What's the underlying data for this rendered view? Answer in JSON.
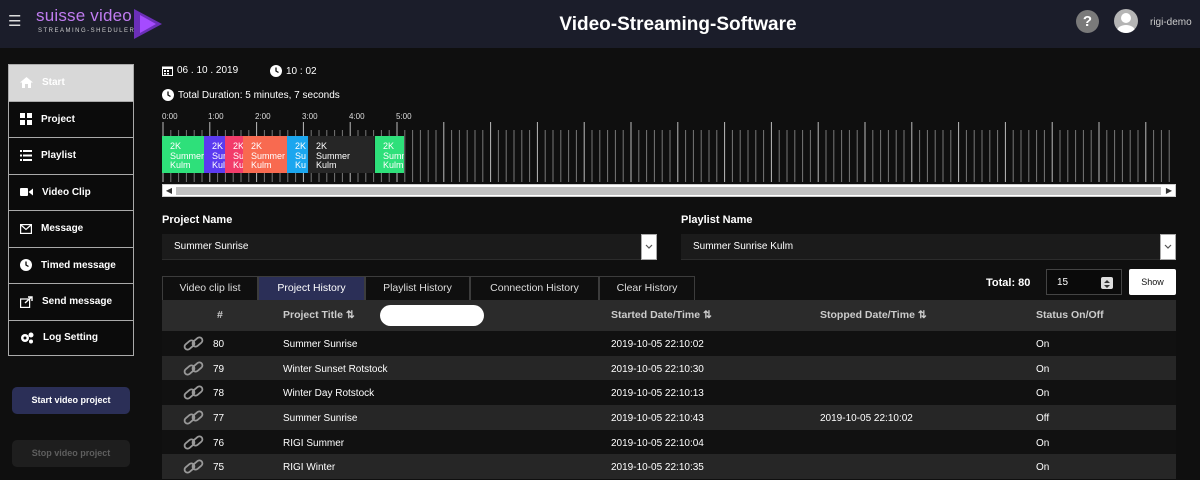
{
  "header": {
    "menu_icon": "hamburger-icon",
    "logo_text": "suisse video",
    "logo_subtitle": "STREAMING-SHEDULER",
    "title": "Video-Streaming-Software",
    "help_label": "?",
    "username": "rigi-demo"
  },
  "sidebar": {
    "items": [
      {
        "label": "Start",
        "icon": "home-icon",
        "active": true
      },
      {
        "label": "Project",
        "icon": "grid-icon"
      },
      {
        "label": "Playlist",
        "icon": "list-icon"
      },
      {
        "label": "Video Clip",
        "icon": "video-camera-icon"
      },
      {
        "label": "Message",
        "icon": "envelope-icon"
      },
      {
        "label": "Timed message",
        "icon": "clock-icon"
      },
      {
        "label": "Send message",
        "icon": "share-icon"
      },
      {
        "label": "Log Setting",
        "icon": "gears-icon"
      }
    ],
    "start_button": "Start video project",
    "stop_button": "Stop video project"
  },
  "info": {
    "date": "06 . 10 . 2019",
    "time": "10 : 02",
    "total_duration": "Total Duration: 5 minutes, 7 seconds"
  },
  "timeline": {
    "labels": [
      "0:00",
      "1:00",
      "2:00",
      "3:00",
      "4:00",
      "5:00"
    ],
    "clips": [
      {
        "text": "2K\nSummer\nKulm",
        "color": "#2ee07a"
      },
      {
        "text": "2K\nSum\nKul",
        "color": "#5b3bf0"
      },
      {
        "text": "2K\nSu\nKu",
        "color": "#f23c6a"
      },
      {
        "text": "2K\nSummer\nKulm",
        "color": "#f86a50"
      },
      {
        "text": "2K\nSu\nKu",
        "color": "#1aa6ef"
      },
      {
        "text": "2K\nSummer\nKulm",
        "color": "#262626"
      },
      {
        "text": "2K\nSummer\nKulm",
        "color": "#2ee07a"
      }
    ]
  },
  "project": {
    "label": "Project Name",
    "value": "Summer Sunrise"
  },
  "playlist": {
    "label": "Playlist Name",
    "value": "Summer Sunrise Kulm"
  },
  "tabs": [
    "Video clip list",
    "Project History",
    "Playlist History",
    "Connection History",
    "Clear History"
  ],
  "active_tab": "Project History",
  "pager": {
    "total": "Total: 80",
    "page_size": "15",
    "show_label": "Show"
  },
  "table": {
    "columns": [
      "#",
      "Project Title",
      "Started Date/Time",
      "Stopped Date/Time",
      "Status On/Off"
    ],
    "rows": [
      {
        "id": "80",
        "title": "Summer Sunrise",
        "started": "2019-10-05 22:10:02",
        "stopped": "",
        "status": "On"
      },
      {
        "id": "79",
        "title": "Winter Sunset Rotstock",
        "started": "2019-10-05 22:10:30",
        "stopped": "",
        "status": "On"
      },
      {
        "id": "78",
        "title": "Winter Day Rotstock",
        "started": "2019-10-05 22:10:13",
        "stopped": "",
        "status": "On"
      },
      {
        "id": "77",
        "title": "Summer Sunrise",
        "started": "2019-10-05 22:10:43",
        "stopped": "2019-10-05 22:10:02",
        "status": "Off"
      },
      {
        "id": "76",
        "title": "RIGI Summer",
        "started": "2019-10-05 22:10:04",
        "stopped": "",
        "status": "On"
      },
      {
        "id": "75",
        "title": "RIGI Winter",
        "started": "2019-10-05 22:10:35",
        "stopped": "",
        "status": "On"
      }
    ]
  },
  "colors": {
    "accent": "#2b2f57",
    "logo": "#c07cf0"
  }
}
